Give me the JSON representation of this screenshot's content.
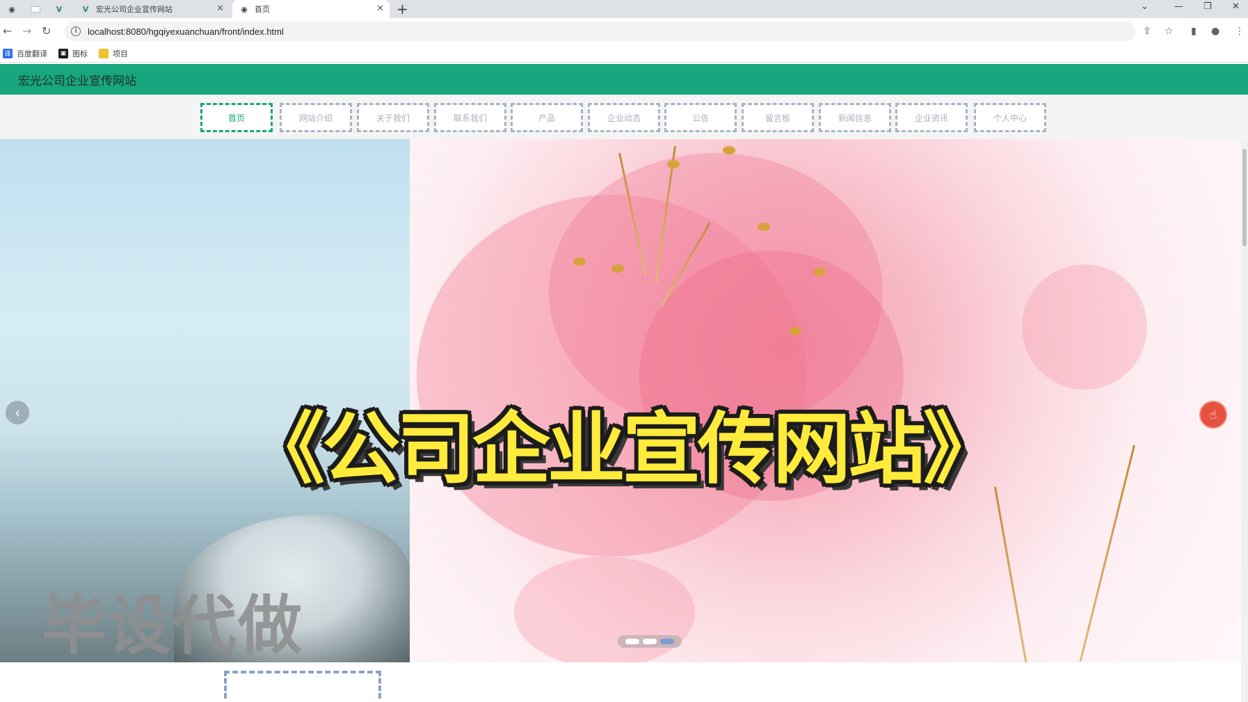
{
  "tabs": [
    {
      "label": "",
      "icon": "globe-icon",
      "pinned": true
    },
    {
      "label": "",
      "icon": "blank-page-icon",
      "pinned": true
    },
    {
      "label": "",
      "icon": "vue-icon",
      "pinned": true
    },
    {
      "label": "宏光公司企业宣传网站",
      "icon": "vue-icon"
    },
    {
      "label": "首页",
      "icon": "globe-icon",
      "active": true
    }
  ],
  "address_bar": {
    "url": "localhost:8080/hgqiyexuanchuan/front/index.html"
  },
  "bookmarks": [
    {
      "label": "百度翻译",
      "icon": "translate-icon",
      "color": "#2e6de5"
    },
    {
      "label": "图标",
      "icon": "image-icon",
      "color": "#1a1a1a"
    },
    {
      "label": "项目",
      "icon": "folder-icon",
      "color": "#f2c230"
    }
  ],
  "site": {
    "title": "宏光公司企业宣传网站",
    "header_color": "#17a67d",
    "nav": [
      {
        "label": "首页",
        "active": true
      },
      {
        "label": "网站介绍"
      },
      {
        "label": "关于我们"
      },
      {
        "label": "联系我们"
      },
      {
        "label": "产品"
      },
      {
        "label": "企业动态"
      },
      {
        "label": "公告"
      },
      {
        "label": "留言板"
      },
      {
        "label": "新闻信息"
      },
      {
        "label": "企业资讯"
      },
      {
        "label": "个人中心"
      }
    ]
  },
  "carousel": {
    "overlay_title": "《公司企业宣传网站》",
    "watermark": "毕设代做",
    "slide_count": 3,
    "active_index": 2,
    "prev_icon": "chevron-left-icon",
    "next_icon": "hand-cursor-icon"
  }
}
